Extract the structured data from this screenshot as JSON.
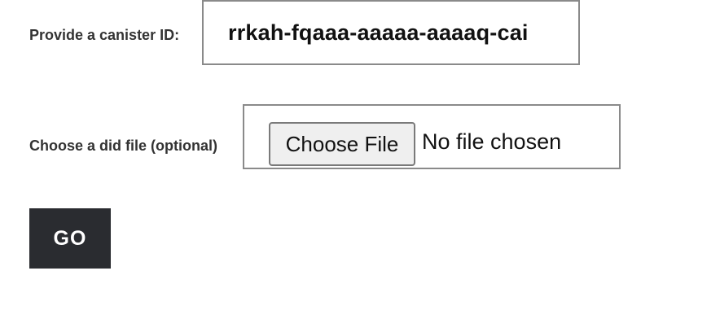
{
  "form": {
    "canister_label": "Provide a canister ID:",
    "canister_value": "rrkah-fqaaa-aaaaa-aaaaq-cai",
    "did_label": "Choose a did file (optional)",
    "choose_file_label": "Choose File",
    "file_status": "No file chosen",
    "go_label": "GO"
  },
  "colors": {
    "go_button_bg": "#2a2c30",
    "box_border": "#8a8a8a",
    "file_button_bg": "#efefef"
  }
}
